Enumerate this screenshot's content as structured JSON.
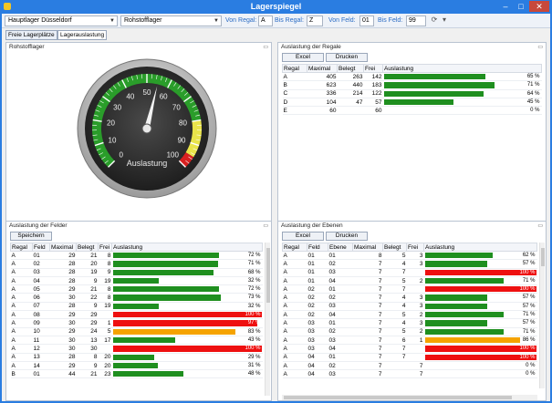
{
  "window": {
    "title": "Lagerspiegel",
    "min": "–",
    "max": "□",
    "close": "✕"
  },
  "toolbar": {
    "lager_combo": "Hauptlager Düsseldorf",
    "lagertyp_combo": "Rohstofflager",
    "von_regal_label": "Von Regal:",
    "von_regal_value": "A",
    "bis_regal_label": "Bis Regal:",
    "bis_regal_value": "Z",
    "von_feld_label": "Von Feld:",
    "von_feld_value": "01",
    "bis_feld_label": "Bis Feld:",
    "bis_feld_value": "99"
  },
  "tabs": [
    {
      "label": "Freie Lagerplätze"
    },
    {
      "label": "Lagerauslastung"
    }
  ],
  "gauge_panel": {
    "title": "Rohstofflager",
    "gauge_label": "Auslastung",
    "value_percent": 55,
    "ticks": [
      "0",
      "10",
      "20",
      "30",
      "40",
      "50",
      "60",
      "70",
      "80",
      "90",
      "100"
    ],
    "colors": {
      "green": "#2a9d2a",
      "yellow": "#e9e44a",
      "red": "#d82020"
    }
  },
  "regale_panel": {
    "title": "Auslastung der Regale",
    "excel_label": "Excel",
    "drucken_label": "Drucken",
    "columns": [
      "Regal",
      "Maximal",
      "Belegt",
      "Frei",
      "Auslastung"
    ],
    "rows": [
      {
        "regal": "A",
        "maximal": "405",
        "belegt": "263",
        "frei": "142",
        "pct": 65,
        "label": "65 %"
      },
      {
        "regal": "B",
        "maximal": "623",
        "belegt": "440",
        "frei": "183",
        "pct": 71,
        "label": "71 %"
      },
      {
        "regal": "C",
        "maximal": "336",
        "belegt": "214",
        "frei": "122",
        "pct": 64,
        "label": "64 %"
      },
      {
        "regal": "D",
        "maximal": "104",
        "belegt": "47",
        "frei": "57",
        "pct": 45,
        "label": "45 %"
      },
      {
        "regal": "E",
        "maximal": "60",
        "belegt": "",
        "frei": "60",
        "pct": 0,
        "label": "0 %"
      }
    ]
  },
  "felder_panel": {
    "title": "Auslastung der Felder",
    "speichern_label": "Speichern",
    "columns": [
      "Regal",
      "Feld",
      "Maximal",
      "Belegt",
      "Frei",
      "Auslastung"
    ],
    "rows": [
      {
        "regal": "A",
        "feld": "01",
        "maximal": "29",
        "belegt": "21",
        "frei": "8",
        "pct": 72,
        "label": "72 %"
      },
      {
        "regal": "A",
        "feld": "02",
        "maximal": "28",
        "belegt": "20",
        "frei": "8",
        "pct": 71,
        "label": "71 %"
      },
      {
        "regal": "A",
        "feld": "03",
        "maximal": "28",
        "belegt": "19",
        "frei": "9",
        "pct": 68,
        "label": "68 %"
      },
      {
        "regal": "A",
        "feld": "04",
        "maximal": "28",
        "belegt": "9",
        "frei": "19",
        "pct": 32,
        "label": "32 %"
      },
      {
        "regal": "A",
        "feld": "05",
        "maximal": "29",
        "belegt": "21",
        "frei": "8",
        "pct": 72,
        "label": "72 %"
      },
      {
        "regal": "A",
        "feld": "06",
        "maximal": "30",
        "belegt": "22",
        "frei": "8",
        "pct": 73,
        "label": "73 %"
      },
      {
        "regal": "A",
        "feld": "07",
        "maximal": "28",
        "belegt": "9",
        "frei": "19",
        "pct": 32,
        "label": "32 %"
      },
      {
        "regal": "A",
        "feld": "08",
        "maximal": "29",
        "belegt": "29",
        "frei": "",
        "pct": 100,
        "label": "100 %"
      },
      {
        "regal": "A",
        "feld": "09",
        "maximal": "30",
        "belegt": "29",
        "frei": "1",
        "pct": 97,
        "label": "97 %"
      },
      {
        "regal": "A",
        "feld": "10",
        "maximal": "29",
        "belegt": "24",
        "frei": "5",
        "pct": 83,
        "label": "83 %"
      },
      {
        "regal": "A",
        "feld": "11",
        "maximal": "30",
        "belegt": "13",
        "frei": "17",
        "pct": 43,
        "label": "43 %"
      },
      {
        "regal": "A",
        "feld": "12",
        "maximal": "30",
        "belegt": "30",
        "frei": "",
        "pct": 100,
        "label": "100 %"
      },
      {
        "regal": "A",
        "feld": "13",
        "maximal": "28",
        "belegt": "8",
        "frei": "20",
        "pct": 29,
        "label": "29 %"
      },
      {
        "regal": "A",
        "feld": "14",
        "maximal": "29",
        "belegt": "9",
        "frei": "20",
        "pct": 31,
        "label": "31 %"
      },
      {
        "regal": "B",
        "feld": "01",
        "maximal": "44",
        "belegt": "21",
        "frei": "23",
        "pct": 48,
        "label": "48 %"
      }
    ]
  },
  "ebenen_panel": {
    "title": "Auslastung der Ebenen",
    "excel_label": "Excel",
    "drucken_label": "Drucken",
    "columns": [
      "Regal",
      "Feld",
      "Ebene",
      "Maximal",
      "Belegt",
      "Frei",
      "Auslastung"
    ],
    "rows": [
      {
        "regal": "A",
        "feld": "01",
        "ebene": "01",
        "maximal": "8",
        "belegt": "5",
        "frei": "3",
        "pct": 62,
        "label": "62 %"
      },
      {
        "regal": "A",
        "feld": "01",
        "ebene": "02",
        "maximal": "7",
        "belegt": "4",
        "frei": "3",
        "pct": 57,
        "label": "57 %"
      },
      {
        "regal": "A",
        "feld": "01",
        "ebene": "03",
        "maximal": "7",
        "belegt": "7",
        "frei": "",
        "pct": 100,
        "label": "100 %"
      },
      {
        "regal": "A",
        "feld": "01",
        "ebene": "04",
        "maximal": "7",
        "belegt": "5",
        "frei": "2",
        "pct": 71,
        "label": "71 %"
      },
      {
        "regal": "A",
        "feld": "02",
        "ebene": "01",
        "maximal": "7",
        "belegt": "7",
        "frei": "",
        "pct": 100,
        "label": "100 %"
      },
      {
        "regal": "A",
        "feld": "02",
        "ebene": "02",
        "maximal": "7",
        "belegt": "4",
        "frei": "3",
        "pct": 57,
        "label": "57 %"
      },
      {
        "regal": "A",
        "feld": "02",
        "ebene": "03",
        "maximal": "7",
        "belegt": "4",
        "frei": "3",
        "pct": 57,
        "label": "57 %"
      },
      {
        "regal": "A",
        "feld": "02",
        "ebene": "04",
        "maximal": "7",
        "belegt": "5",
        "frei": "2",
        "pct": 71,
        "label": "71 %"
      },
      {
        "regal": "A",
        "feld": "03",
        "ebene": "01",
        "maximal": "7",
        "belegt": "4",
        "frei": "3",
        "pct": 57,
        "label": "57 %"
      },
      {
        "regal": "A",
        "feld": "03",
        "ebene": "02",
        "maximal": "7",
        "belegt": "5",
        "frei": "2",
        "pct": 71,
        "label": "71 %"
      },
      {
        "regal": "A",
        "feld": "03",
        "ebene": "03",
        "maximal": "7",
        "belegt": "6",
        "frei": "1",
        "pct": 86,
        "label": "86 %"
      },
      {
        "regal": "A",
        "feld": "03",
        "ebene": "04",
        "maximal": "7",
        "belegt": "7",
        "frei": "",
        "pct": 100,
        "label": "100 %"
      },
      {
        "regal": "A",
        "feld": "04",
        "ebene": "01",
        "maximal": "7",
        "belegt": "7",
        "frei": "",
        "pct": 100,
        "label": "100 %"
      },
      {
        "regal": "A",
        "feld": "04",
        "ebene": "02",
        "maximal": "7",
        "belegt": "",
        "frei": "7",
        "pct": 0,
        "label": "0 %"
      },
      {
        "regal": "A",
        "feld": "04",
        "ebene": "03",
        "maximal": "7",
        "belegt": "",
        "frei": "7",
        "pct": 0,
        "label": "0 %"
      }
    ]
  },
  "bar_colors": {
    "green": "#1f8f1f",
    "orange": "#f5a300",
    "red": "#ee1010"
  }
}
